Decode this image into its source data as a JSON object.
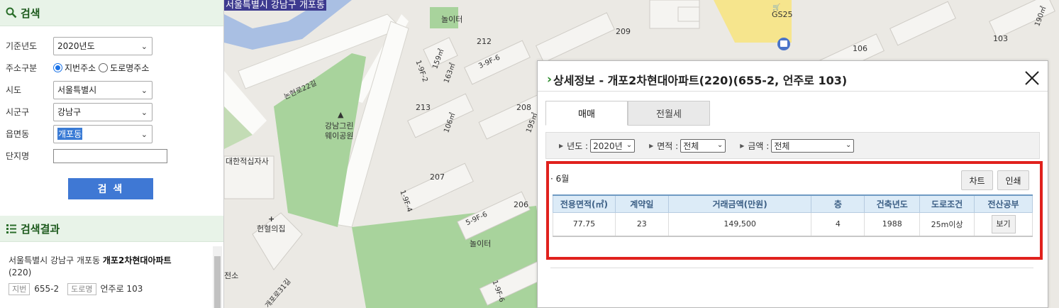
{
  "search_panel": {
    "title": "검색",
    "fields": {
      "year_label": "기준년도",
      "year_value": "2020년도",
      "address_type_label": "주소구분",
      "address_type_options": [
        "지번주소",
        "도로명주소"
      ],
      "sido_label": "시도",
      "sido_value": "서울특별시",
      "sigungu_label": "시군구",
      "sigungu_value": "강남구",
      "dong_label": "읍면동",
      "dong_value": "개포동",
      "complex_label": "단지명",
      "complex_value": ""
    },
    "search_button": "검 색"
  },
  "results_panel": {
    "title": "검색결과",
    "item": {
      "prefix": "서울특별시 강남구 개포동 ",
      "name": "개포2차현대아파트",
      "name2": "(220)",
      "jibun_tag": "지번",
      "jibun": "655-2",
      "road_tag": "도로명",
      "road": "언주로 103"
    }
  },
  "map": {
    "region_title": "서울특별시 강남구 개포동",
    "labels": {
      "playground1": "놀이터",
      "playground2": "놀이터",
      "park1": "강남그린",
      "park2": "웨이공원",
      "redcross": "대한적십자사",
      "clinic": "헌혈의집",
      "road": "논현로22길",
      "road2": "개포로31길",
      "gs25": "GS25",
      "jeonso": "전소",
      "b212": "212",
      "b209": "209",
      "b213": "213",
      "b208": "208",
      "b207": "207",
      "b206": "206",
      "b106": "106",
      "b103": "103",
      "area1": "159㎡",
      "area2": "163㎡",
      "area3": "106㎡",
      "area4": "195㎡",
      "area5": "190㎡",
      "unit1": "1-9F-2",
      "unit2": "3-9F-6",
      "unit3": "1-9F-4",
      "unit4": "5-9F-6",
      "unit5": "1-9F-6"
    }
  },
  "detail_popup": {
    "title": "상세정보 - 개포2차현대아파트(220)(655-2, 언주로 103)",
    "tabs": [
      "매매",
      "전월세"
    ],
    "filters": {
      "year_label": "년도 :",
      "year_value": "2020년",
      "area_label": "면적 :",
      "area_value": "전체",
      "price_label": "금액 :",
      "price_value": "전체"
    },
    "month": "· 6월",
    "chart_button": "차트",
    "print_button": "인쇄",
    "table": {
      "headers": [
        "전용면적(㎡)",
        "계약일",
        "거래금액(만원)",
        "층",
        "건축년도",
        "도로조건",
        "전산공부"
      ],
      "rows": [
        [
          "77.75",
          "23",
          "149,500",
          "4",
          "1988",
          "25m이상",
          "보기"
        ]
      ]
    }
  }
}
